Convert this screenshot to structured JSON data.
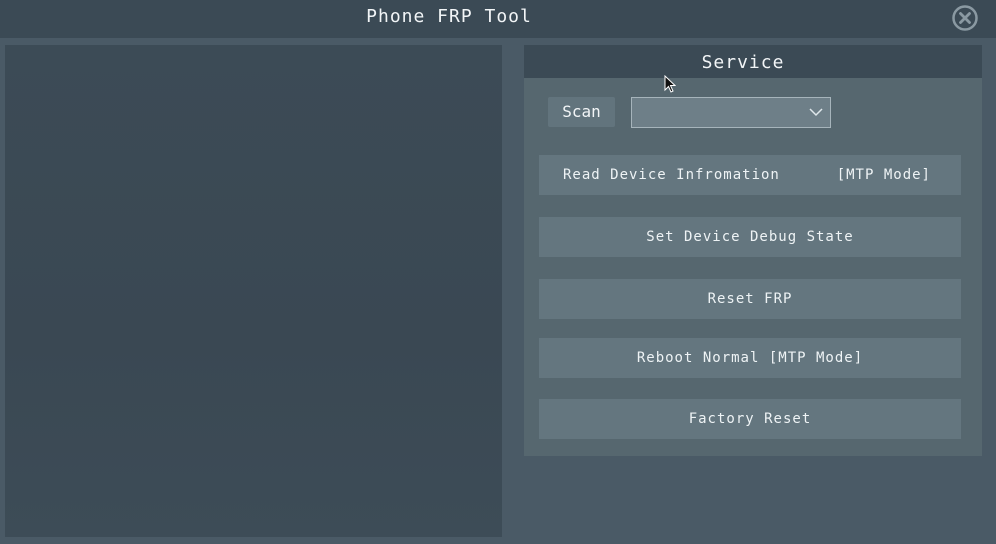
{
  "window": {
    "title": "Phone FRP Tool",
    "close_icon": "close-circle-icon"
  },
  "service": {
    "header": "Service",
    "scan_label": "Scan",
    "device_select_value": "",
    "buttons": [
      {
        "label": "Read Device Infromation",
        "suffix": "[MTP Mode]"
      },
      {
        "label": "Set Device Debug State"
      },
      {
        "label": "Reset FRP"
      },
      {
        "label": "Reboot Normal [MTP Mode]"
      },
      {
        "label": "Factory Reset"
      }
    ]
  },
  "colors": {
    "background": "#4a5a66",
    "titlebar": "#3b4a55",
    "panel": "#56676f",
    "button": "#64767f",
    "text": "#f2f5f7"
  }
}
